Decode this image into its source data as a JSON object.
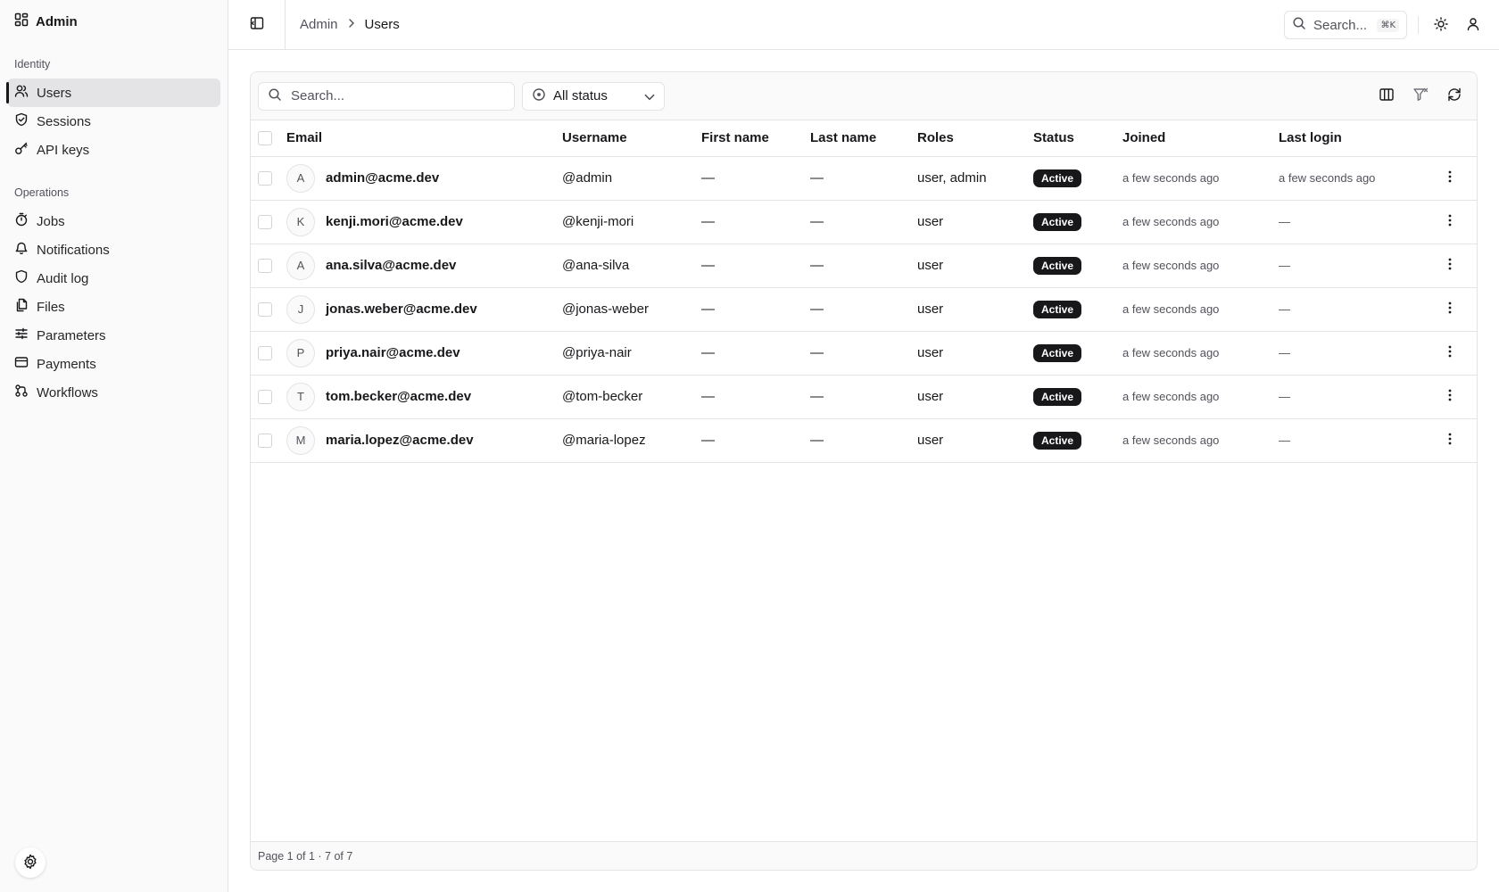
{
  "brand": {
    "title": "Admin"
  },
  "sidebar": {
    "groups": [
      {
        "label": "Identity",
        "items": [
          {
            "label": "Users",
            "icon": "users-icon",
            "active": true
          },
          {
            "label": "Sessions",
            "icon": "shield-icon"
          },
          {
            "label": "API keys",
            "icon": "key-icon"
          }
        ]
      },
      {
        "label": "Operations",
        "items": [
          {
            "label": "Jobs",
            "icon": "timer-icon"
          },
          {
            "label": "Notifications",
            "icon": "bell-icon"
          },
          {
            "label": "Audit log",
            "icon": "shield-icon"
          },
          {
            "label": "Files",
            "icon": "files-icon"
          },
          {
            "label": "Parameters",
            "icon": "sliders-icon"
          },
          {
            "label": "Payments",
            "icon": "credit-card-icon"
          },
          {
            "label": "Workflows",
            "icon": "workflow-icon"
          }
        ]
      }
    ]
  },
  "header": {
    "breadcrumb": {
      "root": "Admin",
      "current": "Users"
    },
    "search": {
      "placeholder": "Search...",
      "shortcut": "⌘K"
    }
  },
  "toolbar": {
    "search_placeholder": "Search...",
    "status_filter": "All status"
  },
  "table": {
    "columns": [
      "Email",
      "Username",
      "First name",
      "Last name",
      "Roles",
      "Status",
      "Joined",
      "Last login"
    ],
    "rows": [
      {
        "initial": "A",
        "email": "admin@acme.dev",
        "username": "@admin",
        "first_name": "—",
        "last_name": "—",
        "roles": "user, admin",
        "status": "Active",
        "joined": "a few seconds ago",
        "last_login": "a few seconds ago"
      },
      {
        "initial": "K",
        "email": "kenji.mori@acme.dev",
        "username": "@kenji-mori",
        "first_name": "—",
        "last_name": "—",
        "roles": "user",
        "status": "Active",
        "joined": "a few seconds ago",
        "last_login": "—"
      },
      {
        "initial": "A",
        "email": "ana.silva@acme.dev",
        "username": "@ana-silva",
        "first_name": "—",
        "last_name": "—",
        "roles": "user",
        "status": "Active",
        "joined": "a few seconds ago",
        "last_login": "—"
      },
      {
        "initial": "J",
        "email": "jonas.weber@acme.dev",
        "username": "@jonas-weber",
        "first_name": "—",
        "last_name": "—",
        "roles": "user",
        "status": "Active",
        "joined": "a few seconds ago",
        "last_login": "—"
      },
      {
        "initial": "P",
        "email": "priya.nair@acme.dev",
        "username": "@priya-nair",
        "first_name": "—",
        "last_name": "—",
        "roles": "user",
        "status": "Active",
        "joined": "a few seconds ago",
        "last_login": "—"
      },
      {
        "initial": "T",
        "email": "tom.becker@acme.dev",
        "username": "@tom-becker",
        "first_name": "—",
        "last_name": "—",
        "roles": "user",
        "status": "Active",
        "joined": "a few seconds ago",
        "last_login": "—"
      },
      {
        "initial": "M",
        "email": "maria.lopez@acme.dev",
        "username": "@maria-lopez",
        "first_name": "—",
        "last_name": "—",
        "roles": "user",
        "status": "Active",
        "joined": "a few seconds ago",
        "last_login": "—"
      }
    ]
  },
  "footer": {
    "pagination": "Page 1 of 1 · 7 of 7"
  },
  "colors": {
    "accent": "#18181b",
    "border": "#e4e4e7",
    "muted": "#52525b",
    "surface": "#fafafa"
  }
}
